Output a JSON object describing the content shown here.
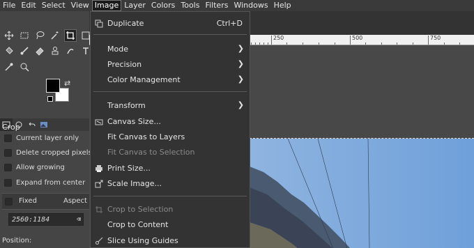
{
  "menubar": {
    "items": [
      "File",
      "Edit",
      "Select",
      "View",
      "Image",
      "Layer",
      "Colors",
      "Tools",
      "Filters",
      "Windows",
      "Help"
    ],
    "active": "Image"
  },
  "image_menu": {
    "duplicate": {
      "label": "Duplicate",
      "shortcut": "Ctrl+D"
    },
    "mode": "Mode",
    "precision": "Precision",
    "color_management": "Color Management",
    "transform": "Transform",
    "canvas_size": "Canvas Size...",
    "fit_canvas_layers": "Fit Canvas to Layers",
    "fit_canvas_selection": "Fit Canvas to Selection",
    "print_size": "Print Size...",
    "scale_image": "Scale Image...",
    "crop_to_selection": "Crop to Selection",
    "crop_to_content": "Crop to Content",
    "slice_using_guides": "Slice Using Guides"
  },
  "tool_options": {
    "title": "Crop",
    "current_layer_only": "Current layer only",
    "delete_cropped_pixels": "Delete cropped pixels",
    "allow_growing": "Allow growing",
    "expand_from_center": "Expand from center",
    "fixed": "Fixed",
    "aspect": "Aspect ra",
    "ratio_value": "2560:1184",
    "position_label": "Position:"
  },
  "ruler": {
    "labels": [
      "250",
      "500",
      "750"
    ]
  },
  "colors": {
    "menu_bg": "#333333",
    "toolbox_bg": "#454545",
    "foreground": "#000000",
    "background": "#ffffff"
  }
}
